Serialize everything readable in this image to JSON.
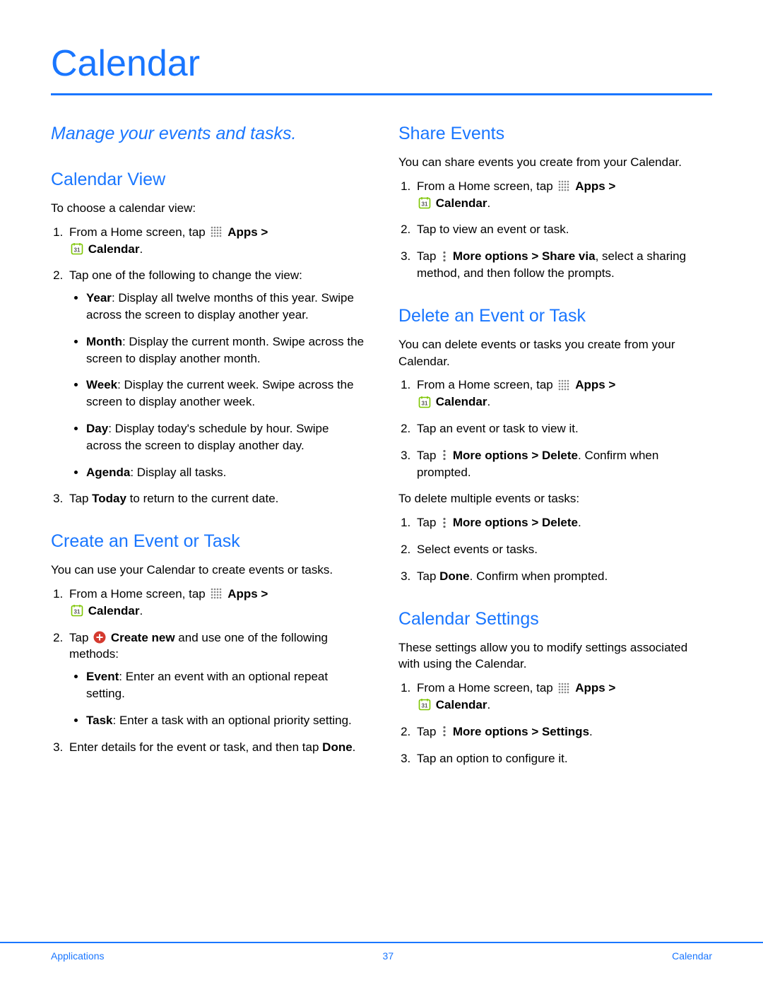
{
  "page": {
    "title": "Calendar",
    "subtitle": "Manage your events and tasks."
  },
  "sections": {
    "view": {
      "heading": "Calendar View",
      "intro": "To choose a calendar view:",
      "step1_pre": "From a Home screen, tap ",
      "apps_label": "Apps",
      "gt": " > ",
      "cal_label": "Calendar",
      "dot": ".",
      "step2": "Tap one of the following to change the view:",
      "bullets": {
        "year_b": "Year",
        "year_t": ": Display all twelve months of this year. Swipe across the screen to display another year.",
        "month_b": "Month",
        "month_t": ": Display the current month. Swipe across the screen to display another month.",
        "week_b": "Week",
        "week_t": ": Display the current week. Swipe across the screen to display another week.",
        "day_b": "Day",
        "day_t": ": Display today's schedule by hour. Swipe across the screen to display another day.",
        "agenda_b": "Agenda",
        "agenda_t": ": Display all tasks."
      },
      "step3_pre": "Tap ",
      "step3_b": "Today",
      "step3_post": " to return to the current date."
    },
    "create": {
      "heading": "Create an Event or Task",
      "intro": "You can use your Calendar to create events or tasks.",
      "step2_pre": "Tap ",
      "step2_b": "Create new",
      "step2_post": " and use one of the following methods:",
      "bullets": {
        "event_b": "Event",
        "event_t": ": Enter an event with an optional repeat setting.",
        "task_b": "Task",
        "task_t": ": Enter a task with an optional priority setting."
      },
      "step3_pre": "Enter details for the event or task, and then tap ",
      "step3_b": "Done",
      "step3_post": "."
    },
    "share": {
      "heading": "Share Events",
      "intro": "You can share events you create from your Calendar.",
      "step2": "Tap to view an event or task.",
      "step3_pre": "Tap ",
      "step3_b": "More options > Share via",
      "step3_post": ", select a sharing method, and then follow the prompts."
    },
    "delete": {
      "heading": "Delete an Event or Task",
      "intro": "You can delete events or tasks you create from your Calendar.",
      "step2": "Tap an event or task to view it.",
      "step3_pre": "Tap ",
      "step3_b1": "More options > Delete",
      "step3_post": ". Confirm when prompted.",
      "multi_intro": "To delete multiple events or tasks:",
      "m1_pre": "Tap ",
      "m1_b": "More options > Delete",
      "m1_post": ".",
      "m2": "Select events or tasks.",
      "m3_pre": "Tap ",
      "m3_b": "Done",
      "m3_post": ". Confirm when prompted."
    },
    "settings": {
      "heading": "Calendar Settings",
      "intro": "These settings allow you to modify settings associated with using the Calendar.",
      "step2_pre": "Tap ",
      "step2_b": "More options > Settings",
      "step2_post": ".",
      "step3": "Tap an option to configure it."
    }
  },
  "footer": {
    "left": "Applications",
    "center": "37",
    "right": "Calendar"
  }
}
